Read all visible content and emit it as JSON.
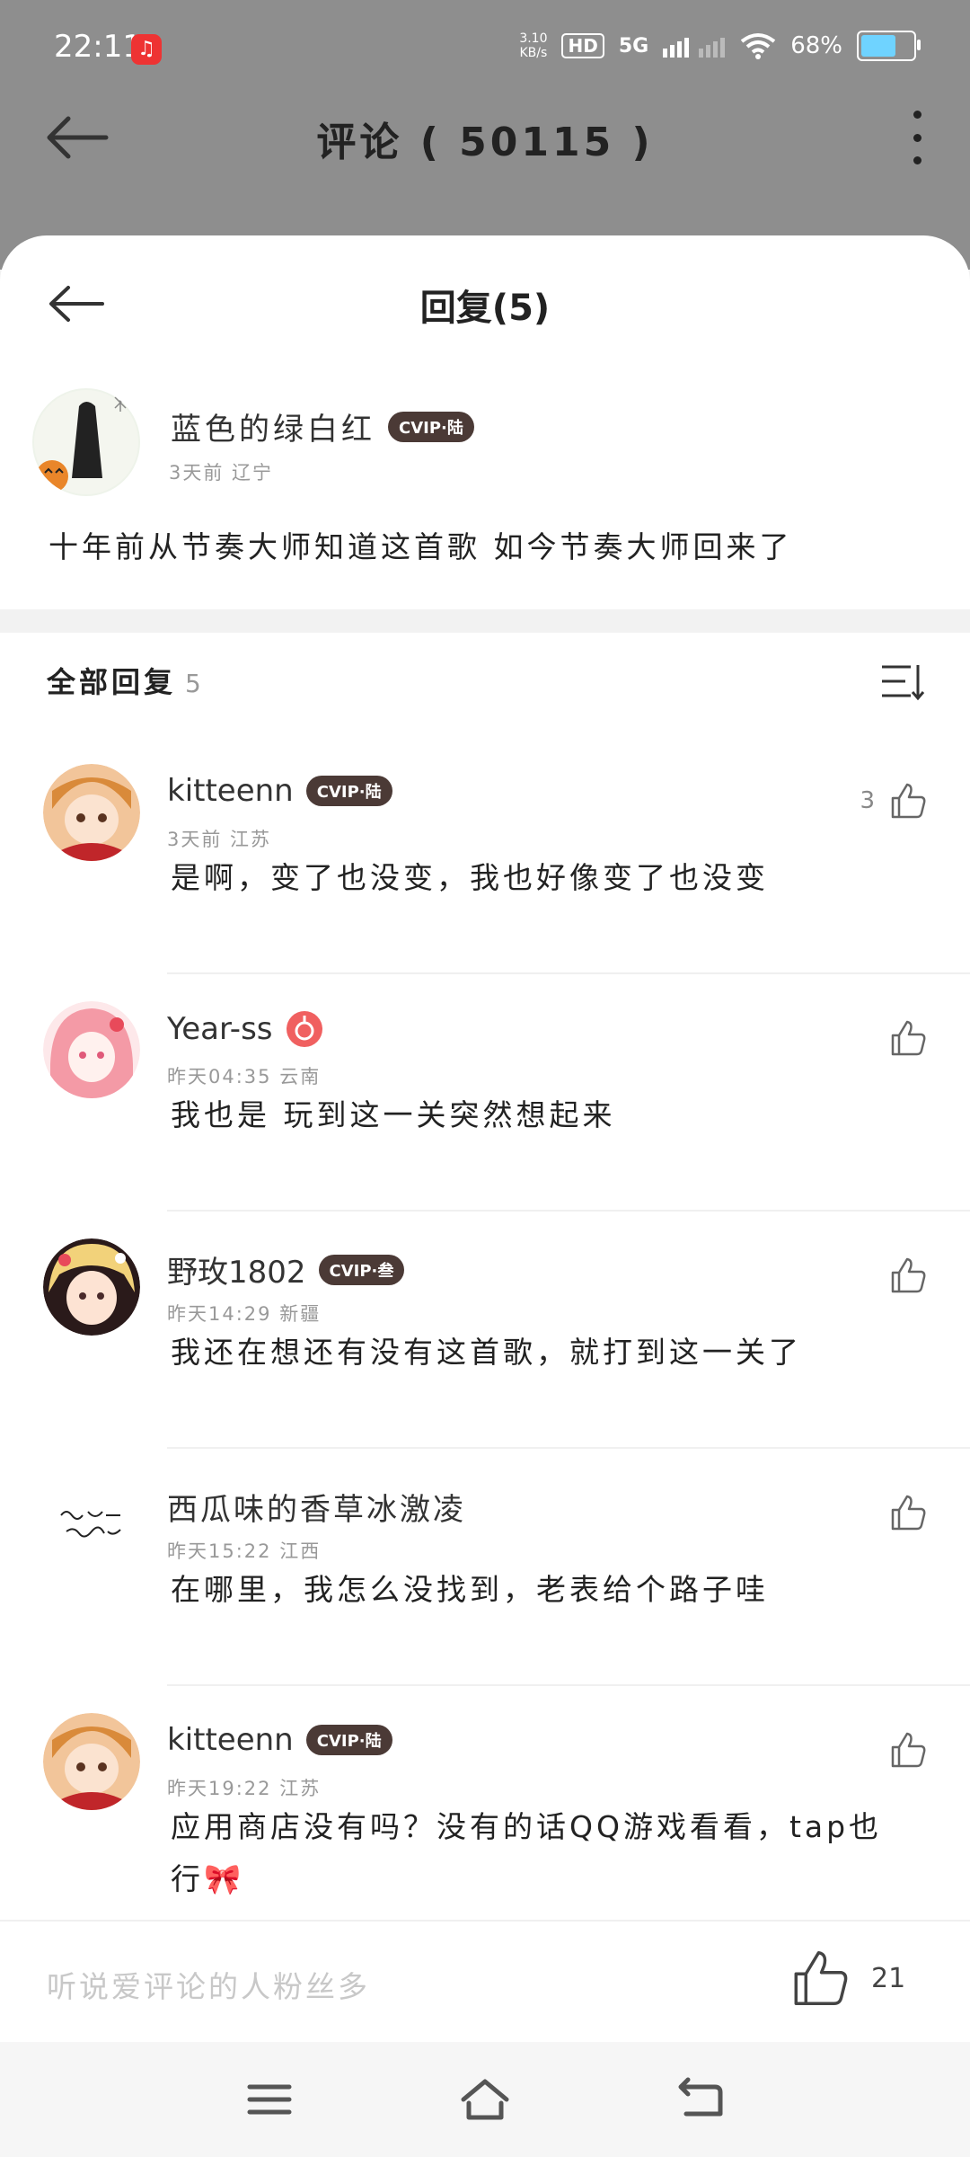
{
  "status_bar": {
    "time": "22:11",
    "speed_value": "3.10",
    "speed_unit": "KB/s",
    "hd_label": "HD",
    "network_label": "5G",
    "battery_percent": "68%",
    "battery_level": 0.68
  },
  "header": {
    "title": "评论 ( 50115 )"
  },
  "reply_sheet": {
    "title": "回复(5)",
    "original_comment": {
      "username": "蓝色的绿白红",
      "badge": "CVIP·陆",
      "meta": "3天前 辽宁",
      "text": "十年前从节奏大师知道这首歌 如今节奏大师回来了"
    },
    "section_title": "全部回复",
    "section_count": "5",
    "replies": [
      {
        "username": "kitteenn",
        "badge": "CVIP·陆",
        "meta": "3天前 江苏",
        "text": "是啊，变了也没变，我也好像变了也没变",
        "likes": "3"
      },
      {
        "username": "Year-ss",
        "badge": "",
        "meta": "昨天04:35 云南",
        "text": "我也是 玩到这一关突然想起来",
        "likes": ""
      },
      {
        "username": "野玫1802",
        "badge": "CVIP·叁",
        "meta": "昨天14:29 新疆",
        "text": "我还在想还有没有这首歌，就打到这一关了",
        "likes": ""
      },
      {
        "username": "西瓜味的香草冰激凌",
        "badge": "",
        "meta": "昨天15:22 江西",
        "text": "在哪里，我怎么没找到，老表给个路子哇",
        "likes": ""
      },
      {
        "username": "kitteenn",
        "badge": "CVIP·陆",
        "meta": "昨天19:22 江苏",
        "text": "应用商店没有吗？没有的话QQ游戏看看，tap也",
        "text2": "行🎀",
        "likes": ""
      }
    ]
  },
  "bottom_bar": {
    "input_placeholder": "听说爱评论的人粉丝多",
    "like_count": "21"
  },
  "colors": {
    "badge_bg": "#4b3a36",
    "music_badge": "#f06060",
    "overlay": "#8e8e8e"
  }
}
